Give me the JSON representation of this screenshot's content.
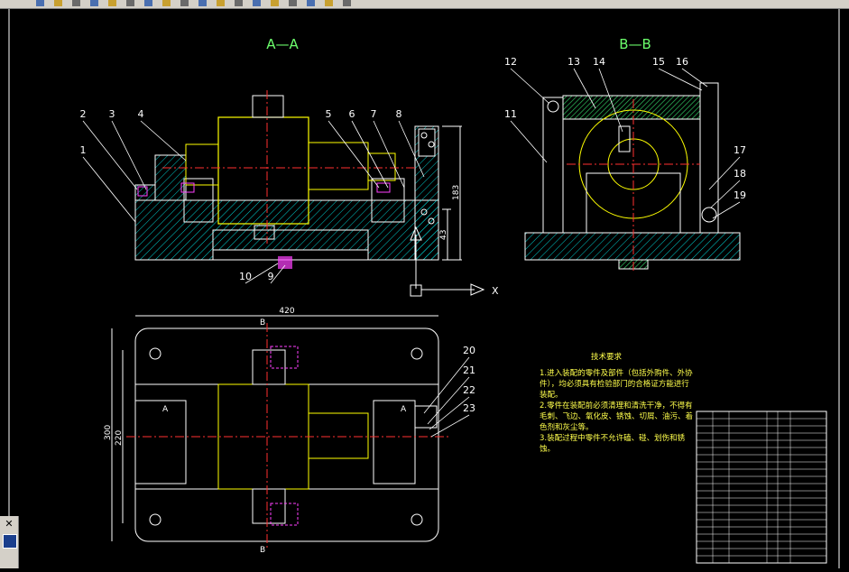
{
  "toolbar": {
    "icon_names": [
      "new-icon",
      "open-icon",
      "save-icon",
      "print-icon",
      "cut-icon",
      "copy-icon",
      "paste-icon",
      "undo-icon",
      "redo-icon",
      "pan-icon",
      "zoom-icon",
      "zoom-window-icon",
      "properties-icon",
      "layers-icon",
      "text-style-icon",
      "dim-style-icon",
      "table-icon",
      "block-icon"
    ]
  },
  "drawing": {
    "view_aa_title": "A—A",
    "view_bb_title": "B—B",
    "dimensions": {
      "width_top": "420",
      "height_outer": "300",
      "height_inner": "220",
      "right_height": "183",
      "right_small": "43"
    },
    "callouts_aa": [
      "1",
      "2",
      "3",
      "4",
      "5",
      "6",
      "7",
      "8",
      "9",
      "10"
    ],
    "callouts_bb": [
      "11",
      "12",
      "13",
      "14",
      "15",
      "16",
      "17",
      "18",
      "19"
    ],
    "callouts_plan": [
      "20",
      "21",
      "22",
      "23"
    ],
    "section_marks": {
      "a": "A",
      "b": "B"
    },
    "axis_x": "X",
    "tech_notes": {
      "title": "技术要求",
      "lines": [
        "1.进入装配的零件及部件（包括外购件、外协",
        "件），均必须具有检验部门的合格证方能进行",
        "装配。",
        "2.零件在装配前必须清理和清洗干净，不得有",
        "毛刺、飞边、氧化皮、锈蚀、切屑、油污、着",
        "色剂和灰尘等。",
        "3.装配过程中零件不允许磕、碰、划伤和锈",
        "蚀。"
      ]
    }
  },
  "colors": {
    "background": "#000000",
    "outline": "#ffffff",
    "hatch": "#00e0e0",
    "part": "#ffff00",
    "center": "#ff3030",
    "highlight": "#ff40ff",
    "title": "#6cff6c",
    "notes": "#ffff4c"
  }
}
